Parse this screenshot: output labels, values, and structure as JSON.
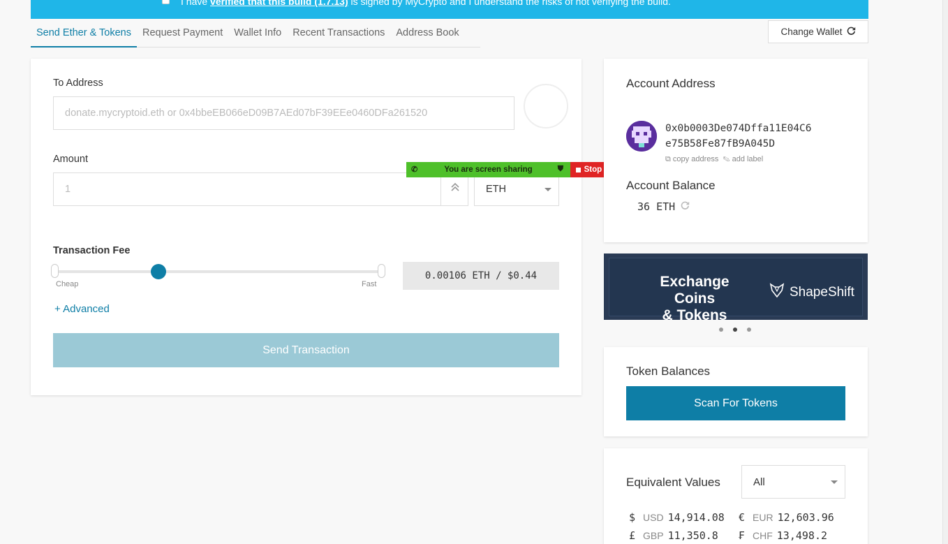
{
  "banner": {
    "prefix": "I have ",
    "link": "verified that this build (1.7.13)",
    "suffix": " is signed by MyCrypto and I understand the risks of not verifying the build."
  },
  "tabs": [
    "Send Ether & Tokens",
    "Request Payment",
    "Wallet Info",
    "Recent Transactions",
    "Address Book"
  ],
  "change_wallet": "Change Wallet",
  "send": {
    "to_label": "To Address",
    "to_placeholder": "donate.mycryptoid.eth or 0x4bbeEB066eD09B7AEd07bF39EEe0460DFa261520",
    "amount_label": "Amount",
    "amount_placeholder": "1",
    "unit": "ETH",
    "fee_label": "Transaction Fee",
    "cheap": "Cheap",
    "fast": "Fast",
    "fee_level": 0.32,
    "fee_value": "0.00106 ETH / $0.44",
    "advanced": "+ Advanced",
    "send_button": "Send Transaction"
  },
  "screen_share": {
    "message": "You are screen sharing",
    "stop": "Stop Share"
  },
  "account": {
    "title": "Account Address",
    "address_line1": "0x0b0003De074Dffa11E04C6",
    "address_line2": "e75B58Fe87fB9A045D",
    "copy": "copy address",
    "add_label": "add label",
    "balance_title": "Account Balance",
    "balance": "36 ETH"
  },
  "shapeshift": {
    "line1": "Exchange Coins",
    "line2": "& Tokens",
    "brand": "ShapeShift"
  },
  "tokens": {
    "title": "Token Balances",
    "scan_button": "Scan For Tokens"
  },
  "equivalent": {
    "title": "Equivalent Values",
    "selected": "All",
    "rates": [
      {
        "symbol": "$",
        "code": "USD",
        "value": "14,914.08"
      },
      {
        "symbol": "€",
        "code": "EUR",
        "value": "12,603.96"
      },
      {
        "symbol": "£",
        "code": "GBP",
        "value": "11,350.8"
      },
      {
        "symbol": "₣",
        "code": "CHF",
        "value": "13,498.2"
      }
    ]
  },
  "colors": {
    "accent": "#0e7ea6",
    "banner": "#1fb6e8",
    "disabled_button": "#9bc9d6",
    "share_green": "#4ec02a",
    "share_red": "#e02424"
  }
}
